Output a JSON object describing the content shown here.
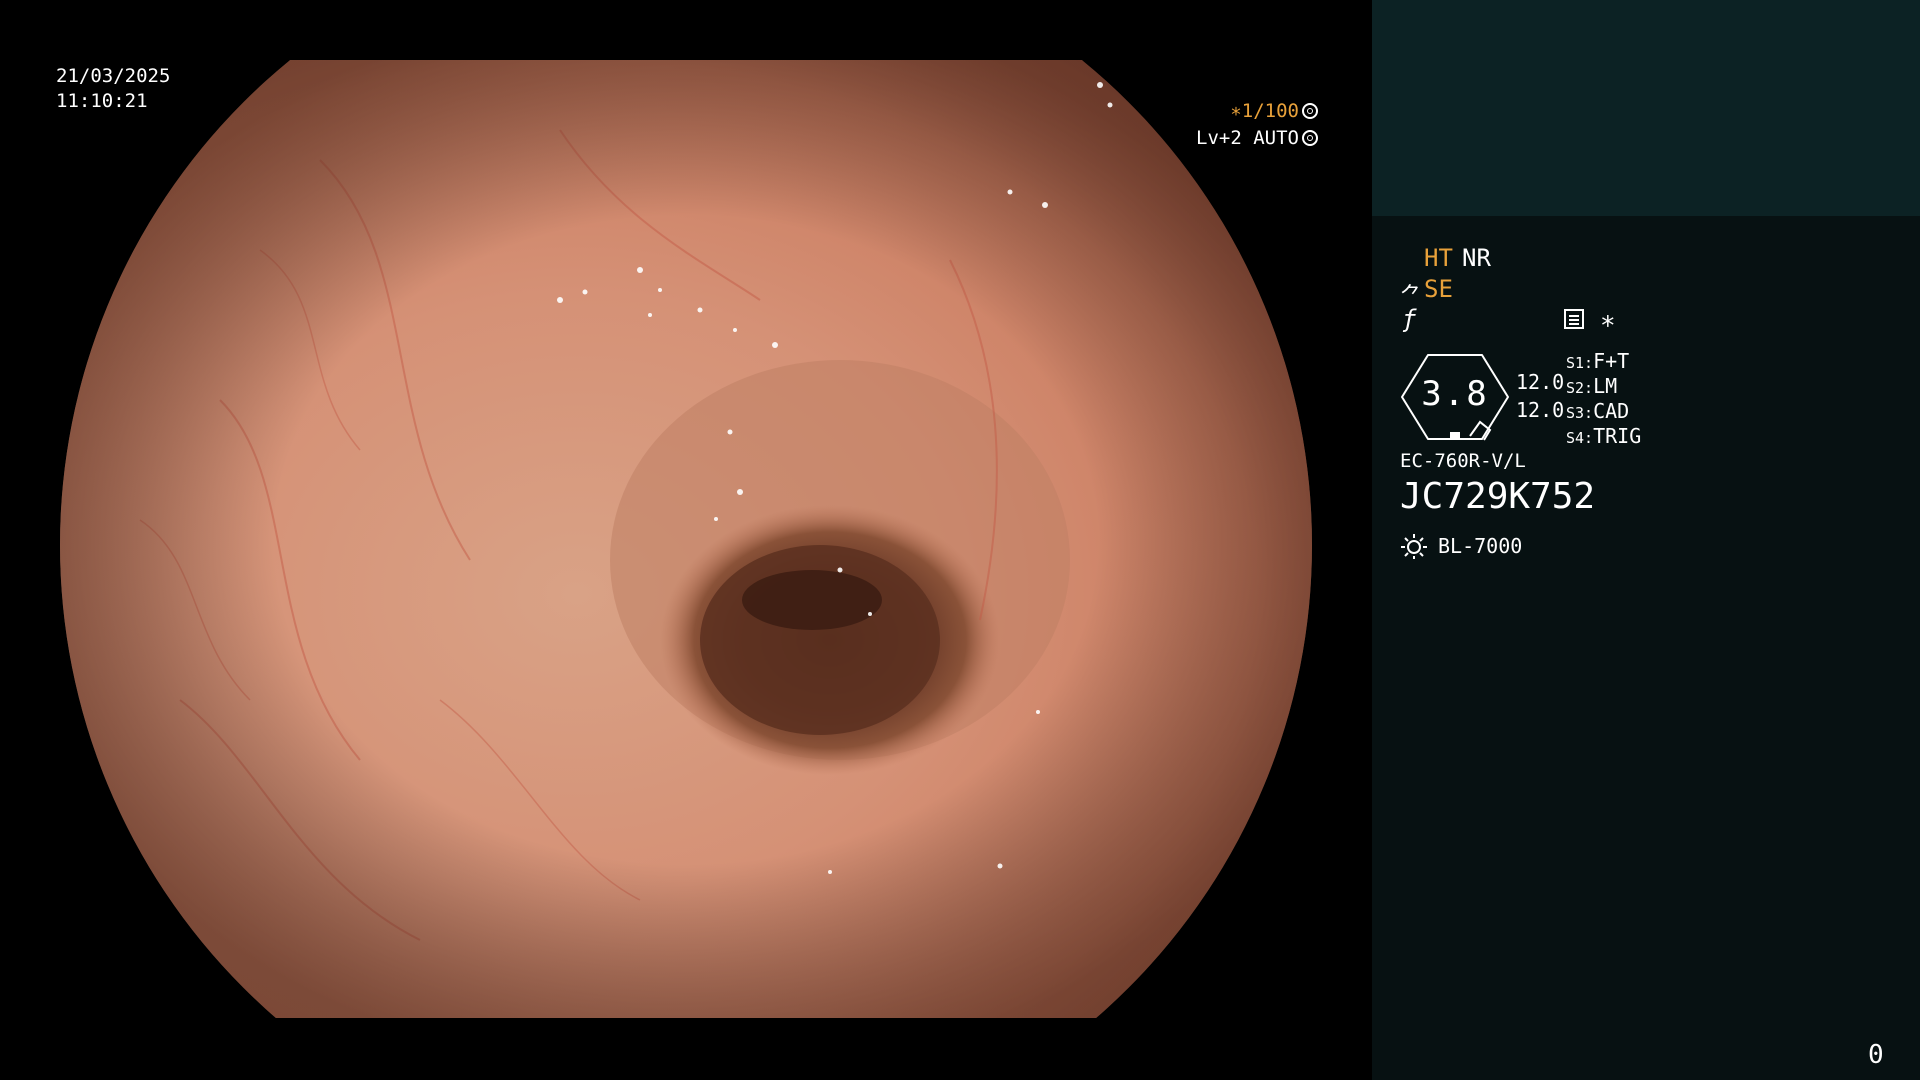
{
  "overlay": {
    "date": "21/03/2025",
    "time": "11:10:21",
    "shutter_mark": "∗",
    "shutter": "1/100",
    "shutter_icon": "aperture-icon",
    "iris_level": "Lv+2 AUTO",
    "iris_icon": "iris-icon"
  },
  "panel": {
    "ht": "HT",
    "nr": "NR",
    "se_icon": "⺈",
    "se": "SE",
    "f_icon": "ƒ",
    "memo_icon": "memo-icon",
    "asterisk": "∗",
    "gauge_value": "3.8",
    "value_1": "12.0",
    "value_2": "12.0",
    "switches": [
      {
        "label": "S1:",
        "value": "F+T"
      },
      {
        "label": "S2:",
        "value": "LM"
      },
      {
        "label": "S3:",
        "value": "CAD"
      },
      {
        "label": "S4:",
        "value": "TRIG"
      }
    ],
    "scope_model": "EC-760R-V/L",
    "scope_serial": "JC729K752",
    "light_icon": "light-source-icon",
    "light_source": "BL-7000",
    "page_number": "0"
  },
  "colors": {
    "accent_orange": "#e8a13a",
    "panel_top": "#0c2224",
    "panel_bg": "#071112"
  }
}
